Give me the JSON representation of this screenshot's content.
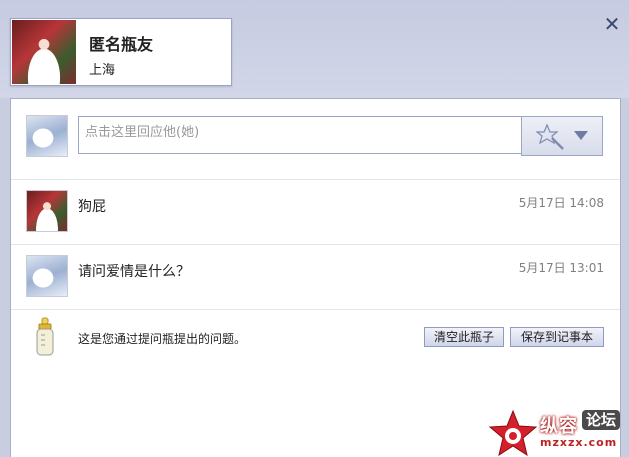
{
  "header": {
    "close_icon": "close-icon",
    "user": {
      "name": "匿名瓶友",
      "location": "上海"
    }
  },
  "reply": {
    "placeholder": "点击这里回应他(她)",
    "emote_icon": "magic-wand-star-icon",
    "dropdown_icon": "chevron-down-icon"
  },
  "messages": [
    {
      "text": "狗屁",
      "time": "5月17日 14:08",
      "avatar": "bride-avatar"
    },
    {
      "text": "请问爱情是什么？",
      "time": "5月17日 13:01",
      "avatar": "anime-avatar"
    }
  ],
  "footer": {
    "note": "这是您通过提问瓶提出的问题。",
    "clear_label": "清空此瓶子",
    "save_label": "保存到记事本",
    "bottle_icon": "baby-bottle-icon"
  },
  "watermark": {
    "text": "纵容",
    "tag": "论坛",
    "sub": "mzxzx.com"
  }
}
